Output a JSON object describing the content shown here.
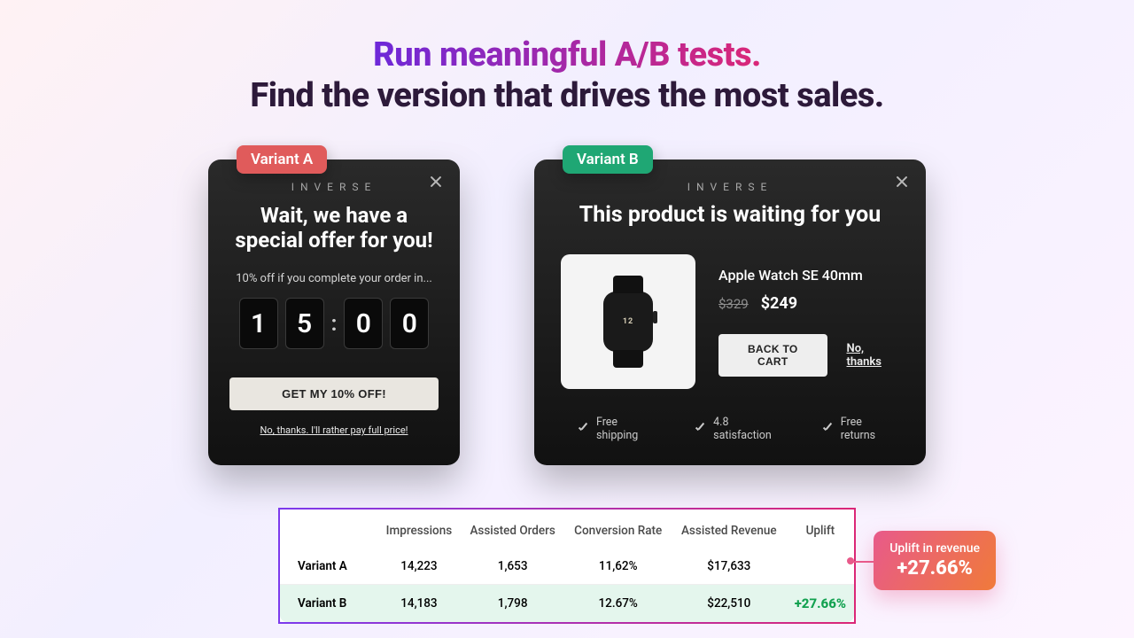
{
  "hero": {
    "line1": "Run meaningful A/B tests.",
    "line2": "Find the version that drives the most sales."
  },
  "brand_text": "INVERSE",
  "variant_a": {
    "badge": "Variant A",
    "title_line1": "Wait, we have a",
    "title_line2": "special offer for you!",
    "subtext": "10% off if you complete your order in...",
    "timer": {
      "d1": "1",
      "d2": "5",
      "d3": "0",
      "d4": "0"
    },
    "cta": "GET MY 10% OFF!",
    "decline": "No, thanks. I'll rather pay full price!"
  },
  "variant_b": {
    "badge": "Variant B",
    "title": "This product is waiting for you",
    "product": {
      "name": "Apple Watch SE 40mm",
      "old_price": "$329",
      "new_price": "$249"
    },
    "cta": "BACK TO CART",
    "decline": "No, thanks",
    "features": {
      "f1": "Free shipping",
      "f2": "4.8 satisfaction",
      "f3": "Free returns"
    }
  },
  "results": {
    "headers": {
      "h1": "Impressions",
      "h2": "Assisted Orders",
      "h3": "Conversion Rate",
      "h4": "Assisted Revenue",
      "h5": "Uplift"
    },
    "row_a": {
      "name": "Variant A",
      "impressions": "14,223",
      "assisted_orders": "1,653",
      "conversion_rate": "11,62%",
      "assisted_revenue": "$17,633",
      "uplift": ""
    },
    "row_b": {
      "name": "Variant B",
      "impressions": "14,183",
      "assisted_orders": "1,798",
      "conversion_rate": "12.67%",
      "assisted_revenue": "$22,510",
      "uplift": "+27.66%"
    }
  },
  "callout": {
    "label": "Uplift in revenue",
    "value": "+27.66%"
  }
}
